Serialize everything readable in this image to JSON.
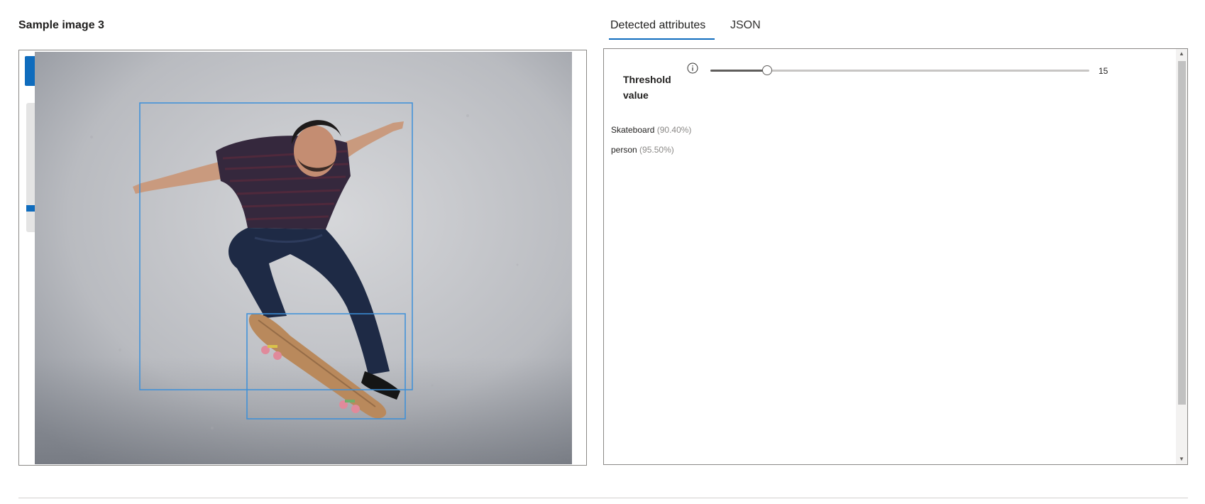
{
  "sample_title": "Sample image 3",
  "image_alt": "Skateboarder performing a trick against a concrete wall",
  "tabs": [
    {
      "label": "Detected attributes",
      "active": true
    },
    {
      "label": "JSON",
      "active": false
    }
  ],
  "threshold": {
    "label": "Threshold value",
    "value": "15",
    "slider_fraction": 0.15
  },
  "attributes": [
    {
      "name": "Skateboard",
      "confidence": "(90.40%)"
    },
    {
      "name": "person",
      "confidence": "(95.50%)"
    }
  ],
  "icons": {
    "info": "info-icon",
    "scroll_up": "chevron-up-icon",
    "scroll_down": "chevron-down-icon"
  },
  "colors": {
    "accent": "#0f6cbd",
    "bounding_box": "#3b8fd9"
  }
}
